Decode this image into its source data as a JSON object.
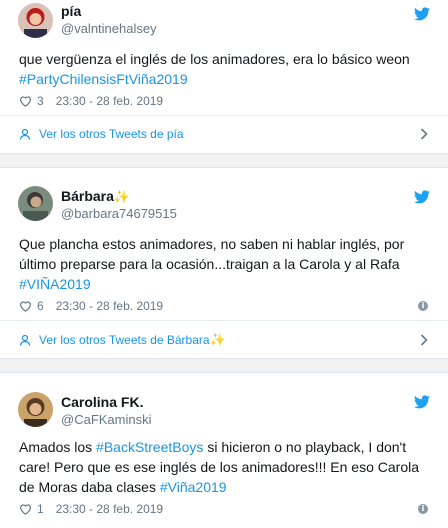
{
  "tweets": [
    {
      "name": "pía",
      "handle": "@valntinehalsey",
      "text_before": "que vergüenza el inglés de los animadores, era lo básico weon",
      "hashtag_line": "#PartyChilensisFtViña2019",
      "likes": "3",
      "time": "23:30 - 28 feb. 2019",
      "more": "Ver los otros Tweets de pía"
    },
    {
      "name": "Bárbara",
      "name_emoji": "✨",
      "handle": "@barbara74679515",
      "line1": "Que plancha estos animadores, no saben ni hablar inglés, por",
      "line2": "último preparse para la ocasión...traigan a la Carola y al Rafa",
      "hashtag": "#VIÑA2019",
      "likes": "6",
      "time": "23:30 - 28 feb. 2019",
      "more": "Ver los otros Tweets de Bárbara",
      "more_emoji": "✨"
    },
    {
      "name": "Carolina FK.",
      "handle": "@CaFKaminski",
      "line1_a": "Amados los ",
      "line1_tag": "#BackStreetBoys",
      "line1_b": " si hicieron o no playback, I don't",
      "line2": "care! Pero que es ese inglés de los animadores!!! En eso Carola",
      "line3_a": "de Moras daba clases ",
      "line3_tag": "#Viña2019",
      "likes": "1",
      "time": "23:30 - 28 feb. 2019"
    }
  ],
  "icons": {
    "twitter": "twitter-bird-icon",
    "heart": "heart-icon",
    "info": "info-icon",
    "user": "user-icon",
    "chevron": "chevron-right-icon"
  },
  "colors": {
    "link": "#1b95e0",
    "muted": "#657786",
    "text": "#14171a",
    "twitter_blue": "#1da1f2"
  }
}
